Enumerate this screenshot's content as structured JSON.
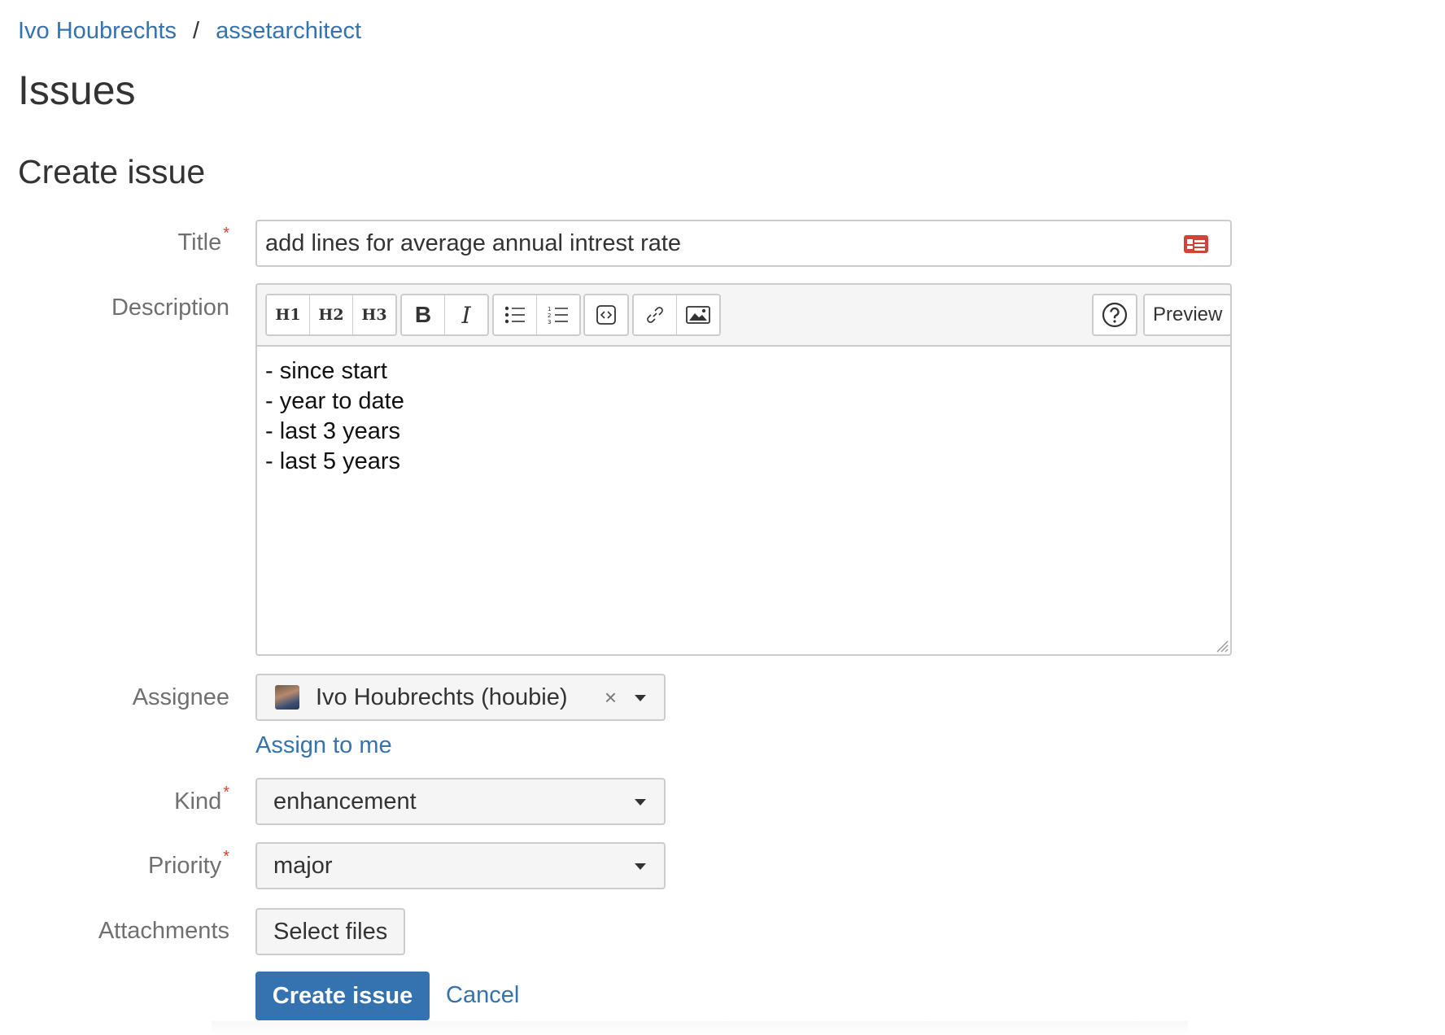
{
  "breadcrumb": {
    "user": "Ivo Houbrechts",
    "separator": "/",
    "repo": "assetarchitect"
  },
  "page_title": "Issues",
  "section_title": "Create issue",
  "form": {
    "title_label": "Title",
    "title_value": "add lines for average annual intrest rate",
    "required_mark": "*",
    "description_label": "Description",
    "toolbar": {
      "h1": "H1",
      "h2": "H2",
      "h3": "H3",
      "bold": "B",
      "italic": "I",
      "preview": "Preview",
      "icons": [
        "bullet-list-icon",
        "numbered-list-icon",
        "code-icon",
        "link-icon",
        "image-icon",
        "help-icon"
      ]
    },
    "description_lines": [
      "- since start",
      "- year to date",
      "- last 3 years",
      "- last 5 years"
    ],
    "assignee_label": "Assignee",
    "assignee_value": "Ivo Houbrechts (houbie)",
    "assignee_clear": "×",
    "assign_to_me": "Assign to me",
    "kind_label": "Kind",
    "kind_value": "enhancement",
    "priority_label": "Priority",
    "priority_value": "major",
    "attachments_label": "Attachments",
    "select_files": "Select files",
    "submit": "Create issue",
    "cancel": "Cancel"
  },
  "colors": {
    "link": "#3572b0",
    "primary_button": "#3572b0",
    "required": "#d04437",
    "card_icon": "#d04437"
  }
}
